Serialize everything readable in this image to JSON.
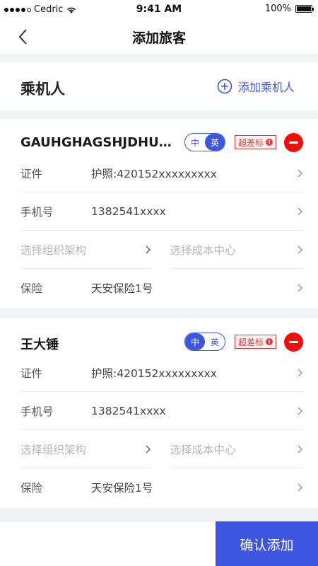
{
  "status_bar": {
    "carrier": "Cedric",
    "time": "9:41 AM",
    "battery": "100%"
  },
  "nav": {
    "title": "添加旅客"
  },
  "section": {
    "title": "乘机人",
    "add_label": "添加乘机人"
  },
  "passengers": [
    {
      "name": "GAUHGHAGSHJDHUHJSDHJ",
      "lang_toggle": {
        "zh": "中",
        "en": "英",
        "selected": "英"
      },
      "badge": "超差标",
      "rows": {
        "id_label": "证件",
        "id_value": "护照:420152xxxxxxxxx",
        "phone_label": "手机号",
        "phone_value": "1382541xxxx",
        "org_placeholder": "选择组织架构",
        "cost_placeholder": "选择成本中心",
        "insurance_label": "保险",
        "insurance_value": "天安保险1号"
      }
    },
    {
      "name": "王大锤",
      "lang_toggle": {
        "zh": "中",
        "en": "英",
        "selected": "中"
      },
      "badge": "超差标",
      "rows": {
        "id_label": "证件",
        "id_value": "护照:420152xxxxxxxxx",
        "phone_label": "手机号",
        "phone_value": "1382541xxxx",
        "org_placeholder": "选择组织架构",
        "cost_placeholder": "选择成本中心",
        "insurance_label": "保险",
        "insurance_value": "天安保险1号"
      }
    }
  ],
  "footer": {
    "confirm_label": "确认添加"
  },
  "colors": {
    "accent": "#3d56e0",
    "danger": "#f20d0d",
    "badge": "#e23b3b"
  },
  "icons": [
    "signal-icon",
    "wifi-icon",
    "battery-icon",
    "back-chevron-icon",
    "add-circle-icon",
    "remove-icon",
    "chevron-right-icon",
    "alert-icon"
  ]
}
